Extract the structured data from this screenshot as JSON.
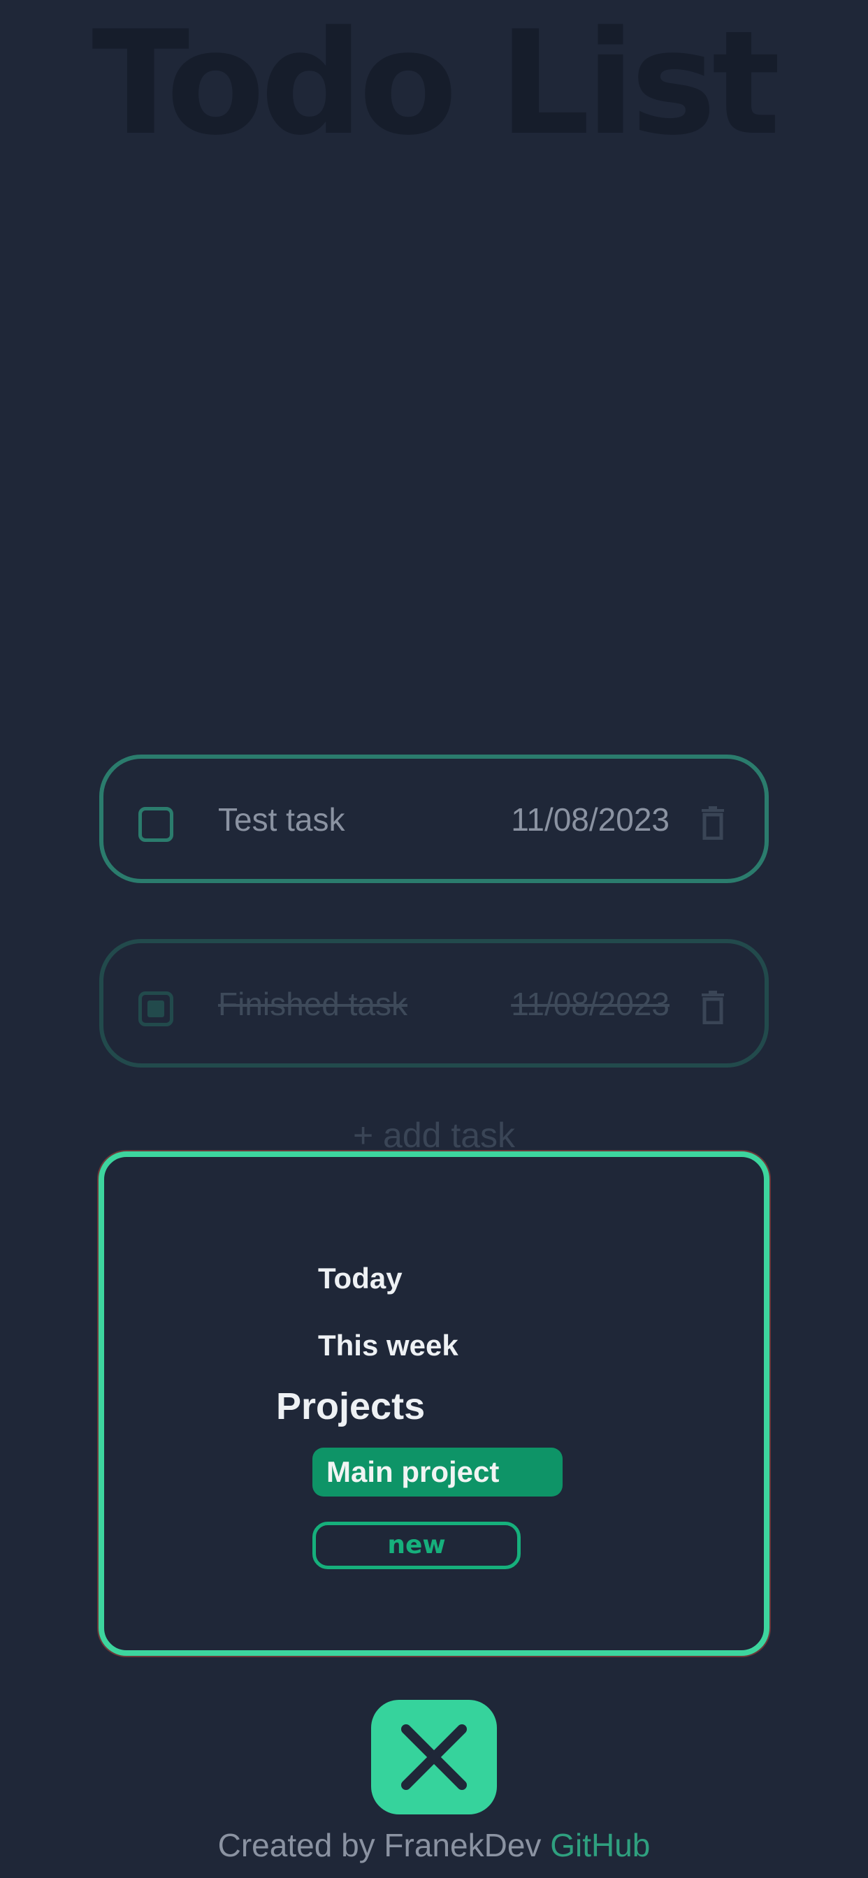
{
  "header": {
    "title": "Todo List"
  },
  "tasks": [
    {
      "name": "Test task",
      "date": "11/08/2023",
      "completed": false
    },
    {
      "name": "Finished task",
      "date": "11/08/2023",
      "completed": true
    }
  ],
  "add_task_label": "+ add task",
  "menu": {
    "items": [
      {
        "label": "Today"
      },
      {
        "label": "This week"
      }
    ],
    "projects_heading": "Projects",
    "projects": [
      {
        "label": "Main project",
        "active": true
      }
    ],
    "new_project_label": "new"
  },
  "close_button": {
    "icon": "close-icon"
  },
  "footer": {
    "credit": "Created by FranekDev",
    "link_label": "GitHub"
  },
  "colors": {
    "background": "#1f2738",
    "accent": "#3dd59e",
    "accent_dark": "#0e9467",
    "task_border": "#2b7c6d",
    "muted_text": "#8b93a2"
  }
}
